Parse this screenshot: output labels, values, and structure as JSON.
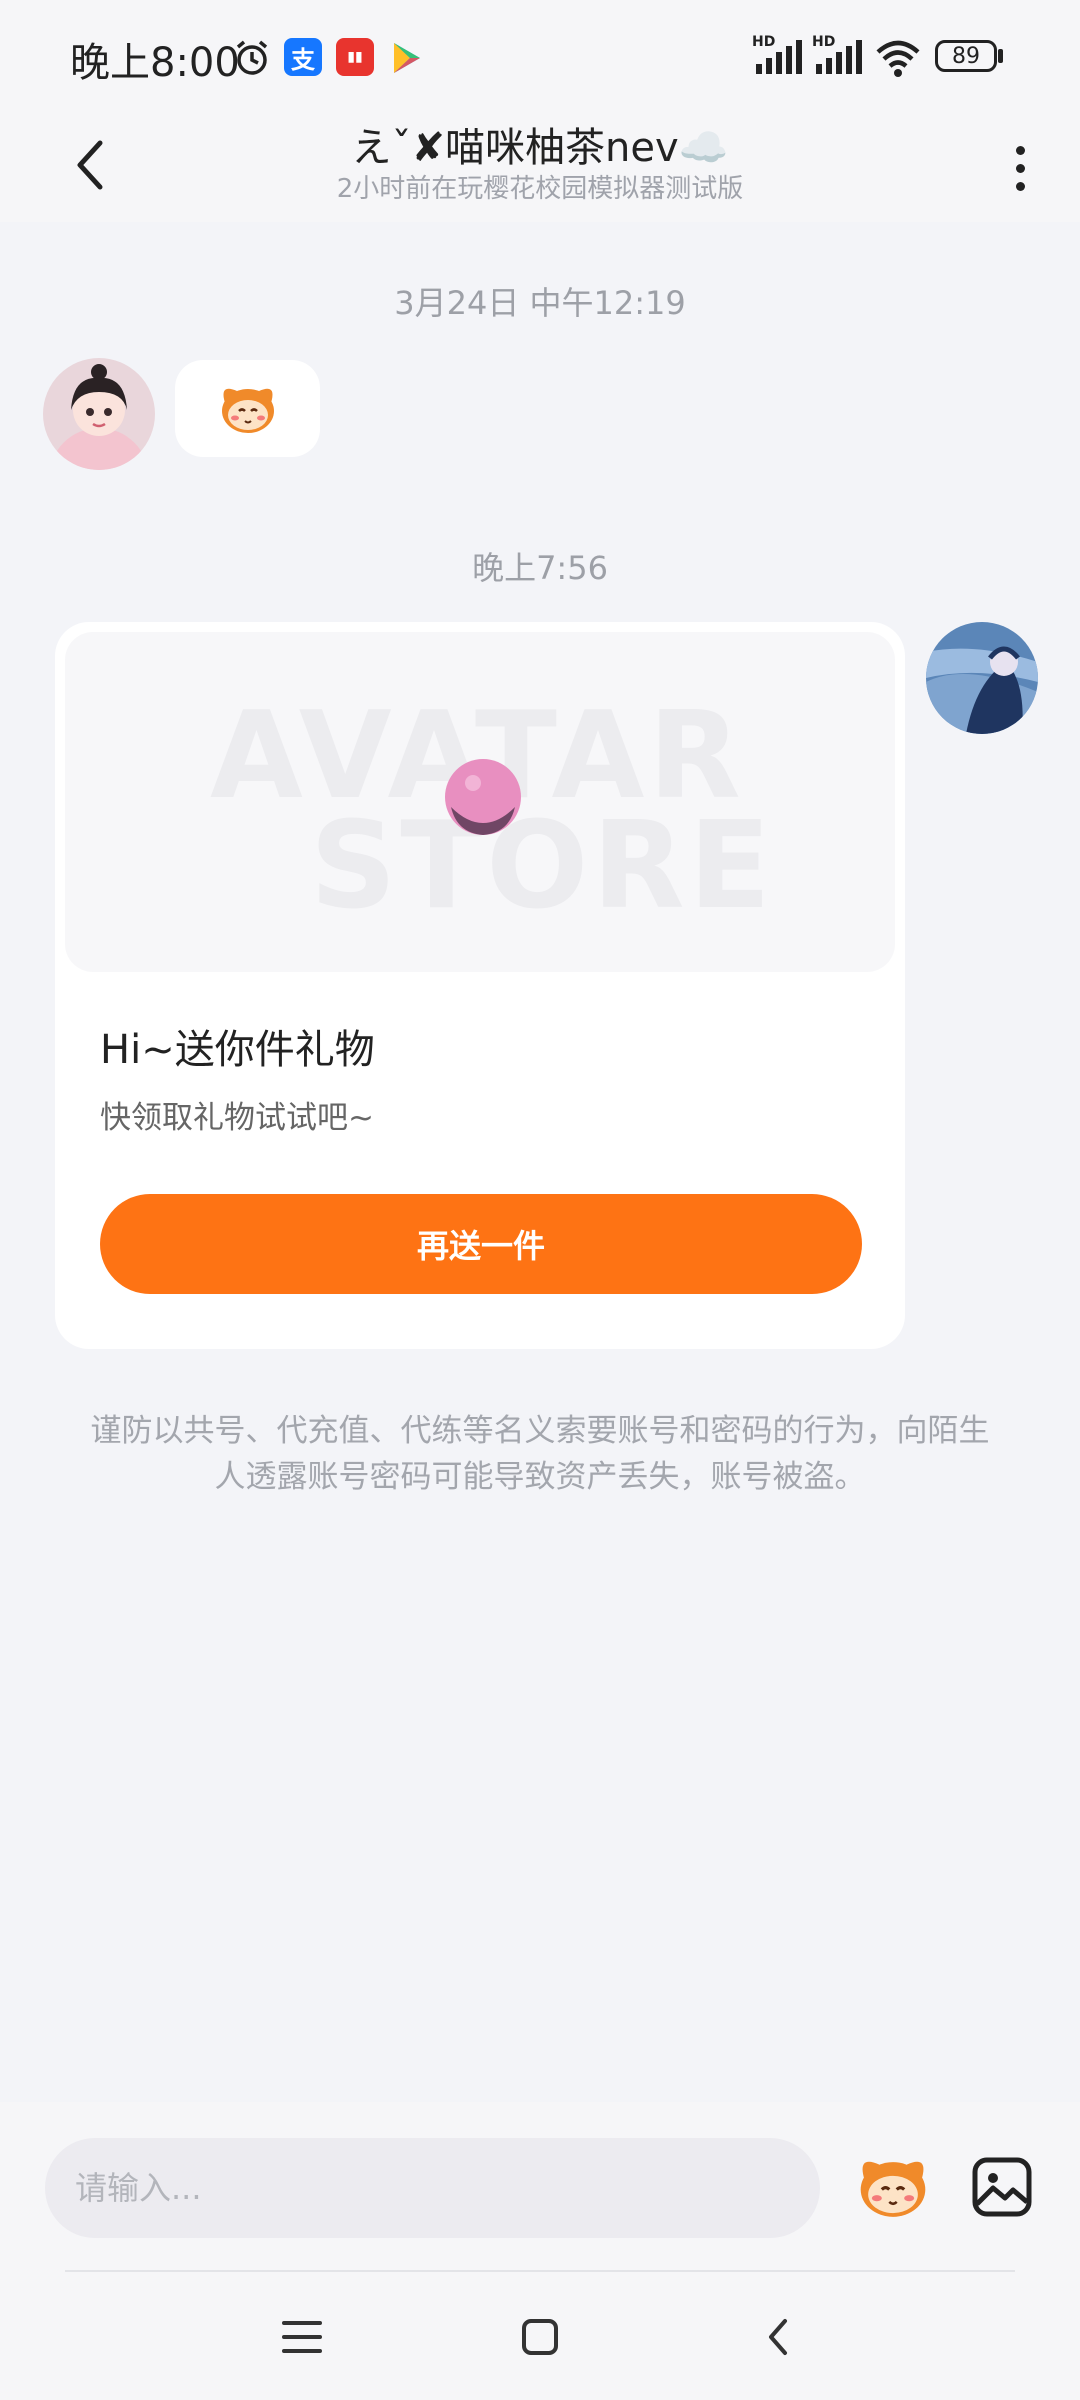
{
  "status_bar": {
    "time": "晚上8:00",
    "alarm_icon": "alarm-clock-icon",
    "app_icons": [
      "alipay-icon",
      "app-badge-icon",
      "play-store-icon"
    ],
    "alipay_label": "支",
    "network": [
      "HD",
      "HD"
    ],
    "battery": "89"
  },
  "header": {
    "title": "えˇ✘喵咪柚茶nev☁️",
    "subtitle": "2小时前在玩樱花校园模拟器测试版"
  },
  "messages": {
    "timestamp_1": "3月24日 中午12:19",
    "timestamp_2": "晚上7:56"
  },
  "gift_card": {
    "title": "Hi~送你件礼物",
    "description": "快领取礼物试试吧~",
    "button_label": "再送一件",
    "watermark_line1": "AVATAR",
    "watermark_line2": "STORE"
  },
  "warning": "谨防以共号、代充值、代练等名义索要账号和密码的行为，向陌生人透露账号密码可能导致资产丢失，账号被盗。",
  "input": {
    "placeholder": "请输入..."
  },
  "colors": {
    "accent": "#fe7314",
    "background": "#f3f4f8"
  }
}
